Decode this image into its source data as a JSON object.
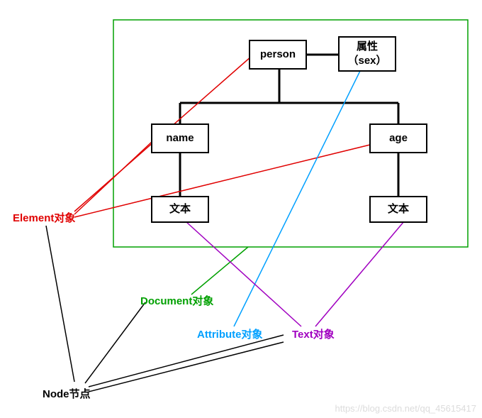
{
  "tree": {
    "root": "person",
    "attr_line1": "属性",
    "attr_line2": "（sex）",
    "child1": "name",
    "child2": "age",
    "text1": "文本",
    "text2": "文本"
  },
  "labels": {
    "element": "Element对象",
    "document": "Document对象",
    "attribute": "Attribute对象",
    "text": "Text对象",
    "node": "Node节点"
  },
  "colors": {
    "element": "#e00000",
    "document": "#00a000",
    "attribute": "#00a0ff",
    "text": "#a000c0",
    "node": "#000000"
  },
  "watermark": "https://blog.csdn.net/qq_45615417"
}
